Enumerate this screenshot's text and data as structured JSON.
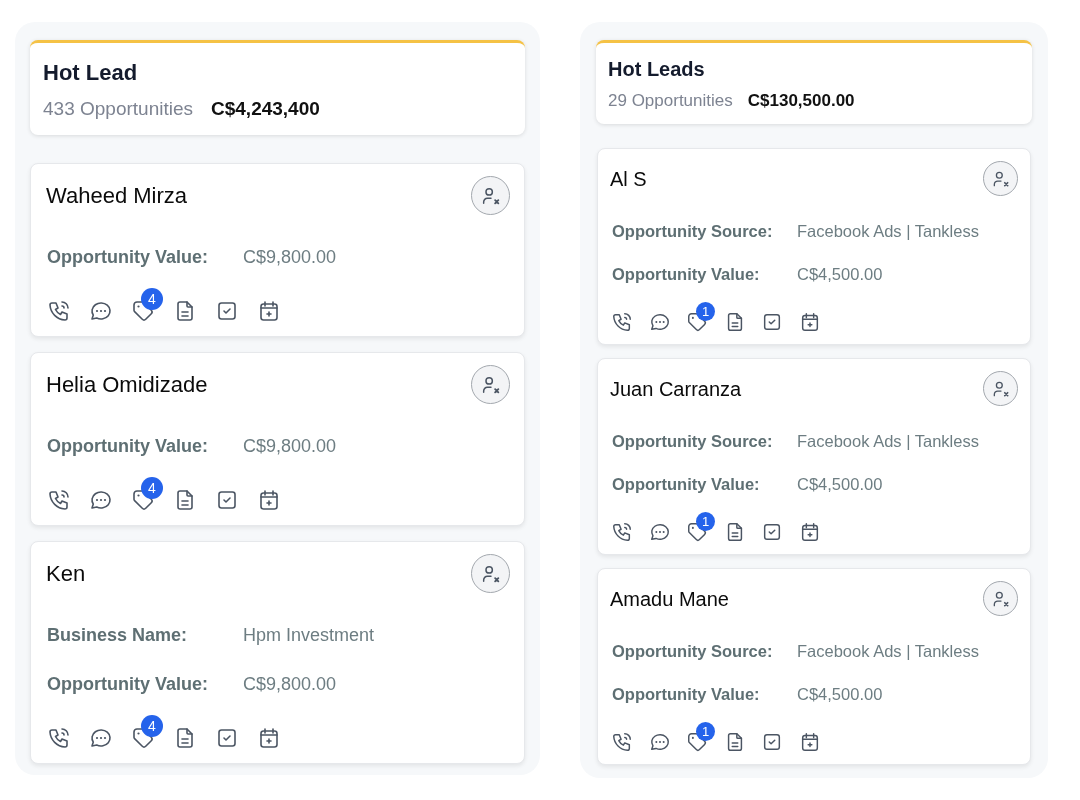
{
  "columns": [
    {
      "title": "Hot Lead",
      "count": "433 Opportunities",
      "total": "C$4,243,400",
      "cards": [
        {
          "name": "Waheed Mirza",
          "fields": [
            {
              "label": "Opportunity Value:",
              "value": "C$9,800.00"
            }
          ],
          "tag_count": "4"
        },
        {
          "name": "Helia Omidizade",
          "fields": [
            {
              "label": "Opportunity Value:",
              "value": "C$9,800.00"
            }
          ],
          "tag_count": "4"
        },
        {
          "name": "Ken",
          "fields": [
            {
              "label": "Business Name:",
              "value": "Hpm Investment"
            },
            {
              "label": "Opportunity Value:",
              "value": "C$9,800.00"
            }
          ],
          "tag_count": "4"
        }
      ]
    },
    {
      "title": "Hot Leads",
      "count": "29 Opportunities",
      "total": "C$130,500.00",
      "cards": [
        {
          "name": "Al S",
          "fields": [
            {
              "label": "Opportunity Source:",
              "value": "Facebook Ads | Tankless"
            },
            {
              "label": "Opportunity Value:",
              "value": "C$4,500.00"
            }
          ],
          "tag_count": "1"
        },
        {
          "name": "Juan Carranza",
          "fields": [
            {
              "label": "Opportunity Source:",
              "value": "Facebook Ads | Tankless"
            },
            {
              "label": "Opportunity Value:",
              "value": "C$4,500.00"
            }
          ],
          "tag_count": "1"
        },
        {
          "name": "Amadu Mane",
          "fields": [
            {
              "label": "Opportunity Source:",
              "value": "Facebook Ads | Tankless"
            },
            {
              "label": "Opportunity Value:",
              "value": "C$4,500.00"
            }
          ],
          "tag_count": "1"
        }
      ]
    }
  ]
}
